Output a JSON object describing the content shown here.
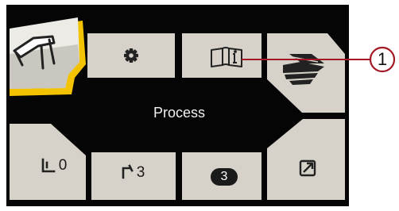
{
  "screen": {
    "title": "Process",
    "buttons": {
      "settings": {
        "icon": "gear-icon"
      },
      "info": {
        "icon": "book-info-icon"
      },
      "process_tool": {
        "icon": "welding-torch-icon",
        "selected": true
      },
      "material": {
        "icon": "layered-sheets-icon"
      },
      "zero": {
        "icon": "corner-step-icon",
        "label": "0"
      },
      "three": {
        "icon": "torch-step-icon",
        "label": "3"
      },
      "badge": {
        "label": "3"
      },
      "export": {
        "icon": "open-external-icon"
      }
    }
  },
  "callout": {
    "number": "1"
  },
  "colors": {
    "screen_bg": "#050505",
    "button": "#d6d2c9",
    "accent": "#f3c200",
    "text_light": "#f2f2f2",
    "callout": "#a31824"
  }
}
